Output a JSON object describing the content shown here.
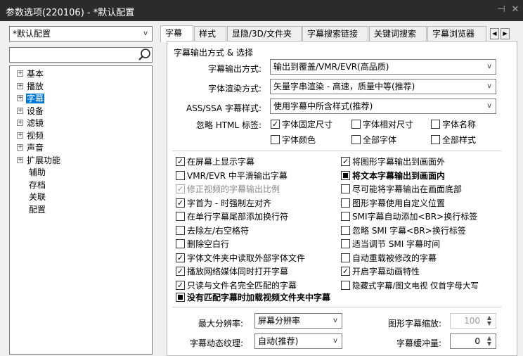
{
  "window": {
    "title": "参数选项(220106) - *默认配置",
    "pin_icon": "pin-icon",
    "close_icon": "close-icon"
  },
  "profile": {
    "selected": "*默认配置"
  },
  "sidebar": {
    "search_value": "",
    "tree": [
      {
        "label": "基本",
        "expandable": true
      },
      {
        "label": "播放",
        "expandable": true
      },
      {
        "label": "字幕",
        "expandable": true,
        "selected": true
      },
      {
        "label": "设备",
        "expandable": true
      },
      {
        "label": "滤镜",
        "expandable": true
      },
      {
        "label": "视频",
        "expandable": true
      },
      {
        "label": "声音",
        "expandable": true
      },
      {
        "label": "扩展功能",
        "expandable": true
      },
      {
        "label": "辅助",
        "expandable": false
      },
      {
        "label": "存档",
        "expandable": false
      },
      {
        "label": "关联",
        "expandable": false
      },
      {
        "label": "配置",
        "expandable": false
      }
    ]
  },
  "tabs": [
    {
      "label": "字幕",
      "active": true
    },
    {
      "label": "样式"
    },
    {
      "label": "显隐/3D/文件夹"
    },
    {
      "label": "字幕搜索链接"
    },
    {
      "label": "关键词搜索"
    },
    {
      "label": "字幕浏览器"
    }
  ],
  "section": {
    "title": "字幕输出方式 & 选择",
    "output_label": "字幕输出方式:",
    "output_value": "输出到覆盖/VMR/EVR(高品质)",
    "render_label": "字体渲染方式:",
    "render_value": "矢量字串渲染 - 高速，质量中等(推荐)",
    "ass_label": "ASS/SSA 字幕样式:",
    "ass_value": "使用字幕中所含样式(推荐)",
    "ignore_label": "忽略 HTML 标签:",
    "ignore_options": [
      {
        "label": "字体固定尺寸",
        "checked": true
      },
      {
        "label": "字体相对尺寸",
        "checked": false
      },
      {
        "label": "字体名称",
        "checked": false
      },
      {
        "label": "字体颜色",
        "checked": false
      },
      {
        "label": "全部字体",
        "checked": false
      },
      {
        "label": "全部样式",
        "checked": false
      }
    ]
  },
  "options_left": [
    {
      "label": "在屏幕上显示字幕",
      "state": "checked"
    },
    {
      "label": "VMR/EVR 中平滑输出字幕",
      "state": "unchecked"
    },
    {
      "label": "修正视频的字幕输出比例",
      "state": "checked",
      "disabled": true
    },
    {
      "label": "字首为 - 时强制左对齐",
      "state": "checked"
    },
    {
      "label": "在单行字幕尾部添加换行符",
      "state": "unchecked"
    },
    {
      "label": "去除左/右空格符",
      "state": "unchecked"
    },
    {
      "label": "删除空白行",
      "state": "unchecked"
    },
    {
      "label": "字体文件夹中读取外部字体文件",
      "state": "checked"
    },
    {
      "label": "播放网络媒体同时打开字幕",
      "state": "checked"
    },
    {
      "label": "只读与文件名完全匹配的字幕",
      "state": "checked"
    }
  ],
  "options_right": [
    {
      "label": "将图形字幕输出到画面外",
      "state": "checked"
    },
    {
      "label": "将文本字幕输出到画面内",
      "state": "indeterminate",
      "bold": true
    },
    {
      "label": "尽可能将字幕输出在画面底部",
      "state": "unchecked"
    },
    {
      "label": "图形字幕使用自定义位置",
      "state": "unchecked"
    },
    {
      "label": "SMI字幕自动添加<BR>换行标签",
      "state": "unchecked"
    },
    {
      "label": "忽略 SMI 字幕<BR>换行标签",
      "state": "unchecked"
    },
    {
      "label": "适当调节 SMI 字幕时间",
      "state": "unchecked"
    },
    {
      "label": "自动重载被修改的字幕",
      "state": "unchecked"
    },
    {
      "label": "开启字幕动画特性",
      "state": "checked"
    },
    {
      "label": "隐藏式字幕/图文电视 仅首字母大写",
      "state": "unchecked"
    }
  ],
  "option_full": {
    "label": "没有匹配字幕时加载视频文件夹中字幕",
    "state": "indeterminate",
    "bold": true
  },
  "bottom": {
    "max_res_label": "最大分辨率:",
    "max_res_value": "屏幕分辨率",
    "texture_label": "字幕动态纹理:",
    "texture_value": "自动(推荐)",
    "scale_label": "图形字幕缩放:",
    "scale_value": "100",
    "buffer_label": "字幕缓冲量:",
    "buffer_value": "0"
  }
}
